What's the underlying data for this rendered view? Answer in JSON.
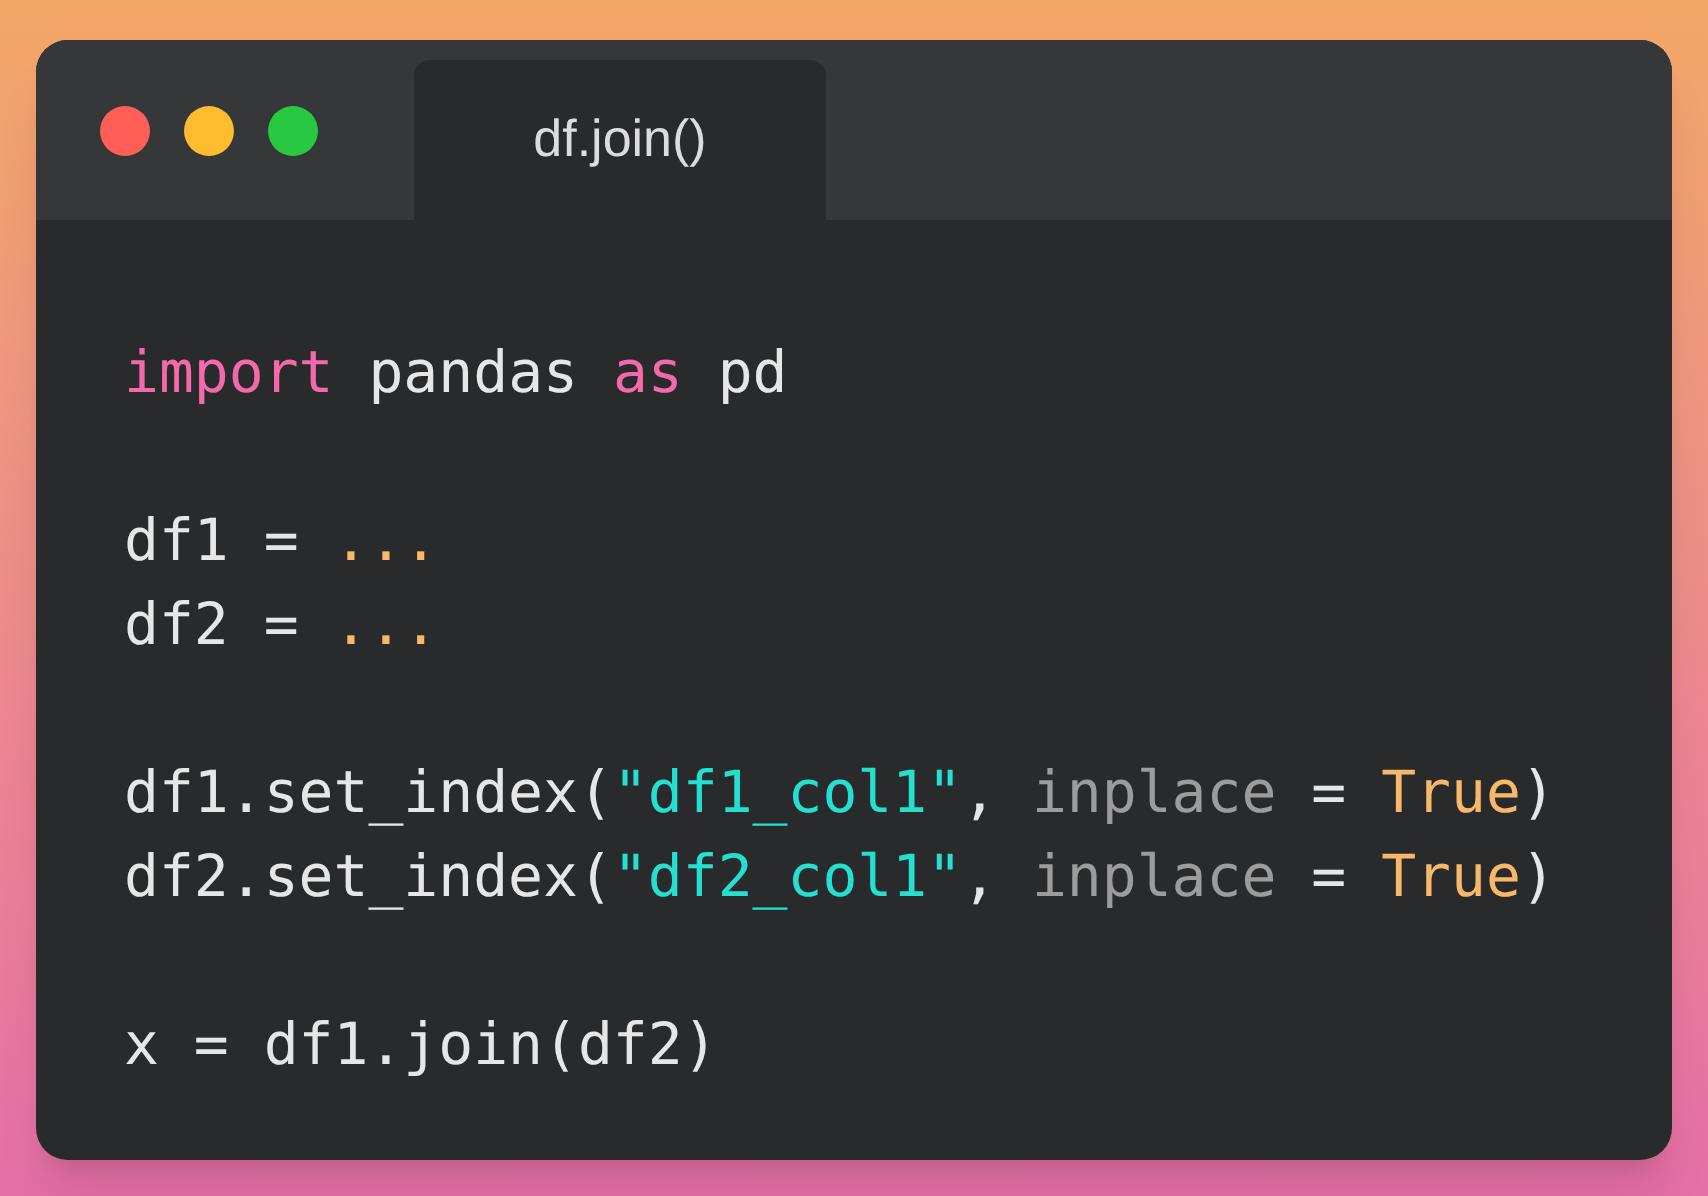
{
  "window": {
    "tab_title": "df.join()"
  },
  "code": [
    {
      "kind": "code",
      "tokens": [
        {
          "kind": "keyword",
          "text": "import"
        },
        {
          "kind": "plain",
          "text": " pandas "
        },
        {
          "kind": "keyword",
          "text": "as"
        },
        {
          "kind": "plain",
          "text": " pd"
        }
      ]
    },
    {
      "kind": "blank"
    },
    {
      "kind": "code",
      "tokens": [
        {
          "kind": "plain",
          "text": "df1 = "
        },
        {
          "kind": "constant",
          "text": "..."
        }
      ]
    },
    {
      "kind": "code",
      "tokens": [
        {
          "kind": "plain",
          "text": "df2 = "
        },
        {
          "kind": "constant",
          "text": "..."
        }
      ]
    },
    {
      "kind": "blank"
    },
    {
      "kind": "code",
      "tokens": [
        {
          "kind": "plain",
          "text": "df1.set_index("
        },
        {
          "kind": "string",
          "text": "\"df1_col1\""
        },
        {
          "kind": "plain",
          "text": ", "
        },
        {
          "kind": "param",
          "text": "inplace"
        },
        {
          "kind": "plain",
          "text": " = "
        },
        {
          "kind": "constant",
          "text": "True"
        },
        {
          "kind": "plain",
          "text": ")"
        }
      ]
    },
    {
      "kind": "code",
      "tokens": [
        {
          "kind": "plain",
          "text": "df2.set_index("
        },
        {
          "kind": "string",
          "text": "\"df2_col1\""
        },
        {
          "kind": "plain",
          "text": ", "
        },
        {
          "kind": "param",
          "text": "inplace"
        },
        {
          "kind": "plain",
          "text": " = "
        },
        {
          "kind": "constant",
          "text": "True"
        },
        {
          "kind": "plain",
          "text": ")"
        }
      ]
    },
    {
      "kind": "blank"
    },
    {
      "kind": "code",
      "tokens": [
        {
          "kind": "plain",
          "text": "x = df1.join(df2)"
        }
      ]
    }
  ]
}
